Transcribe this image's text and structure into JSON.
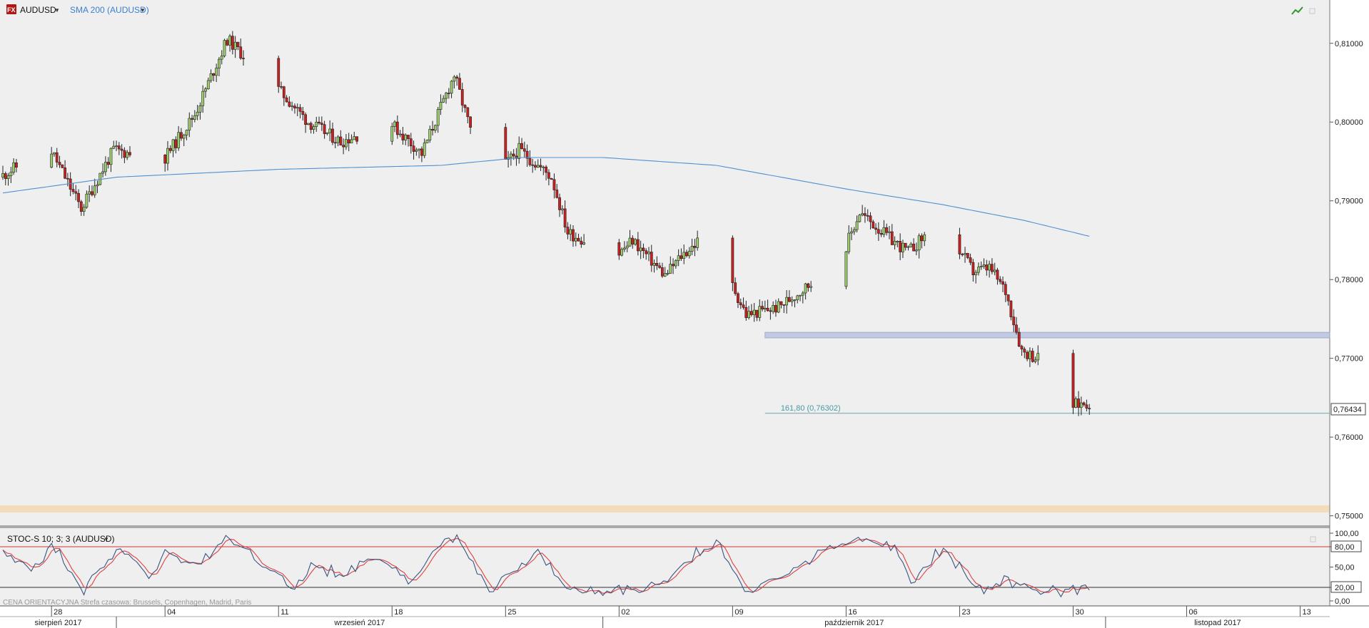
{
  "toolbar": {
    "symbol_badge": "FX",
    "symbol": "AUDUSD",
    "indicator": "SMA 200 (AUDUSD)"
  },
  "price_axis": {
    "labels": [
      "0,81000",
      "0,80000",
      "0,79000",
      "0,78000",
      "0,77000",
      "0,76000",
      "0,75000"
    ],
    "current_price": "0,76434"
  },
  "fib_level": "161,80 (0,76302)",
  "oscillator": {
    "title": "STOC-S 10; 3; 3 (AUDUSD)",
    "labels": [
      "100,00",
      "80,00",
      "50,00",
      "20,00",
      "0,00"
    ]
  },
  "footer": {
    "text": "CENA ORIENTACYJNA    Strefa czasowa: Brussels, Copenhagen, Madrid, Paris"
  },
  "time_axis": {
    "days": [
      "28",
      "04",
      "11",
      "18",
      "25",
      "02",
      "09",
      "16",
      "23",
      "30",
      "06",
      "13"
    ],
    "months": [
      "sierpień 2017",
      "wrzesień 2017",
      "październik 2017",
      "listopad 2017"
    ]
  },
  "colors": {
    "background": "#efefef",
    "bull": "#9ccf6a",
    "bear": "#cc1f1f",
    "sma": "#4f90d0",
    "overbought": "#d43030",
    "stoch_k": "#3a5580",
    "stoch_d": "#e04040",
    "support_zone": "#b9c4de",
    "bottom_zone": "#f3dcbc"
  },
  "chart_data": {
    "type": "candlestick",
    "title": "AUDUSD",
    "x_range": [
      "2017-08-25",
      "2017-11-15"
    ],
    "ylim": [
      0.7487,
      0.8155
    ],
    "timeframe": "H4 (approx.)",
    "anchors": [
      [
        "2017-08-25",
        0.793
      ],
      [
        "2017-08-28",
        0.797
      ],
      [
        "2017-08-30",
        0.789
      ],
      [
        "2017-09-01",
        0.7965
      ],
      [
        "2017-09-04",
        0.795
      ],
      [
        "2017-09-06",
        0.801
      ],
      [
        "2017-09-08",
        0.8105
      ],
      [
        "2017-09-11",
        0.8045
      ],
      [
        "2017-09-13",
        0.8
      ],
      [
        "2017-09-15",
        0.7975
      ],
      [
        "2017-09-18",
        0.8
      ],
      [
        "2017-09-20",
        0.796
      ],
      [
        "2017-09-21",
        0.801
      ],
      [
        "2017-09-22",
        0.806
      ],
      [
        "2017-09-24",
        0.792
      ],
      [
        "2017-09-26",
        0.7965
      ],
      [
        "2017-09-28",
        0.793
      ],
      [
        "2017-09-29",
        0.786
      ],
      [
        "2017-10-02",
        0.783
      ],
      [
        "2017-10-03",
        0.785
      ],
      [
        "2017-10-05",
        0.7805
      ],
      [
        "2017-10-06",
        0.783
      ],
      [
        "2017-10-08",
        0.7865
      ],
      [
        "2017-10-09",
        0.78
      ],
      [
        "2017-10-10",
        0.7755
      ],
      [
        "2017-10-12",
        0.7765
      ],
      [
        "2017-10-14",
        0.7795
      ],
      [
        "2017-10-16",
        0.7835
      ],
      [
        "2017-10-17",
        0.7885
      ],
      [
        "2017-10-19",
        0.785
      ],
      [
        "2017-10-20",
        0.7835
      ],
      [
        "2017-10-22",
        0.7875
      ],
      [
        "2017-10-24",
        0.781
      ],
      [
        "2017-10-25",
        0.7815
      ],
      [
        "2017-10-26",
        0.7785
      ],
      [
        "2017-10-27",
        0.771
      ],
      [
        "2017-10-28",
        0.77
      ],
      [
        "2017-10-29",
        0.7705
      ],
      [
        "2017-10-30",
        0.764
      ],
      [
        "2017-10-31",
        0.7643
      ]
    ],
    "sma_200": [
      [
        "2017-08-25",
        0.791
      ],
      [
        "2017-09-01",
        0.793
      ],
      [
        "2017-09-11",
        0.794
      ],
      [
        "2017-09-21",
        0.7945
      ],
      [
        "2017-09-26",
        0.7955
      ],
      [
        "2017-10-01",
        0.7955
      ],
      [
        "2017-10-08",
        0.7945
      ],
      [
        "2017-10-16",
        0.7915
      ],
      [
        "2017-10-22",
        0.7895
      ],
      [
        "2017-10-27",
        0.7875
      ],
      [
        "2017-10-31",
        0.7855
      ]
    ],
    "support_zone": [
      0.7733,
      0.7726
    ],
    "support_zone_from": "2017-10-11",
    "fib_extension": {
      "label": "161,80",
      "value": 0.76302,
      "from": "2017-10-11"
    },
    "last_price": 0.76434,
    "stochastic": {
      "name": "STOC-S 10; 3; 3 (AUDUSD)",
      "ylim": [
        0,
        100
      ],
      "levels": [
        80,
        20
      ],
      "anchors": [
        [
          "2017-08-25",
          75
        ],
        [
          "2017-08-27",
          45
        ],
        [
          "2017-08-28",
          85
        ],
        [
          "2017-08-30",
          15
        ],
        [
          "2017-09-01",
          80
        ],
        [
          "2017-09-03",
          35
        ],
        [
          "2017-09-04",
          70
        ],
        [
          "2017-09-06",
          55
        ],
        [
          "2017-09-08",
          95
        ],
        [
          "2017-09-12",
          15
        ],
        [
          "2017-09-13",
          55
        ],
        [
          "2017-09-15",
          35
        ],
        [
          "2017-09-17",
          70
        ],
        [
          "2017-09-19",
          25
        ],
        [
          "2017-09-21",
          85
        ],
        [
          "2017-09-22",
          95
        ],
        [
          "2017-09-24",
          15
        ],
        [
          "2017-09-27",
          75
        ],
        [
          "2017-09-29",
          12
        ],
        [
          "2017-10-02",
          15
        ],
        [
          "2017-10-05",
          25
        ],
        [
          "2017-10-06",
          60
        ],
        [
          "2017-10-08",
          85
        ],
        [
          "2017-10-10",
          10
        ],
        [
          "2017-10-12",
          35
        ],
        [
          "2017-10-15",
          80
        ],
        [
          "2017-10-17",
          90
        ],
        [
          "2017-10-19",
          78
        ],
        [
          "2017-10-20",
          30
        ],
        [
          "2017-10-22",
          80
        ],
        [
          "2017-10-24",
          18
        ],
        [
          "2017-10-26",
          30
        ],
        [
          "2017-10-28",
          12
        ],
        [
          "2017-10-30",
          18
        ],
        [
          "2017-10-31",
          16
        ]
      ]
    }
  }
}
